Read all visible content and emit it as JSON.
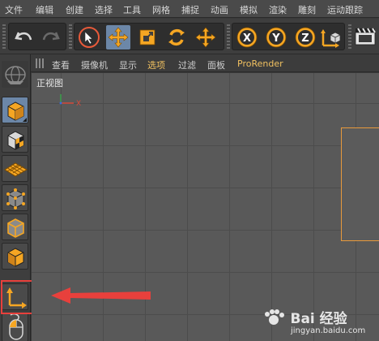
{
  "menu": [
    "文件",
    "编辑",
    "创建",
    "选择",
    "工具",
    "网格",
    "捕捉",
    "动画",
    "模拟",
    "渲染",
    "雕刻",
    "运动跟踪"
  ],
  "toolbar": {
    "undo_icon": "undo-icon",
    "redo_icon": "redo-icon",
    "tools": [
      "live-select-icon",
      "move-icon",
      "scale-icon",
      "rotate-icon",
      "move-plus-icon"
    ],
    "axes": [
      "X",
      "Y",
      "Z"
    ],
    "world_icon": "coordinate-system-icon",
    "render_icon": "clapper-icon"
  },
  "left_palette": [
    "cube-edit-icon",
    "texture-cube-icon",
    "plane-grid-icon",
    "points-cube-icon",
    "edges-cube-icon",
    "polygons-cube-icon",
    "axis-icon",
    "mouse-icon"
  ],
  "viewport": {
    "menu": [
      "查看",
      "摄像机",
      "显示",
      "选项",
      "过滤",
      "面板",
      "ProRender"
    ],
    "label": "正视图",
    "axis_x": "X"
  },
  "watermark": {
    "logo": "Bai 经验",
    "url": "jingyan.baidu.com"
  },
  "colors": {
    "accent_orange": "#f0a23a",
    "highlight_blue": "#6c87a8",
    "annotation_red": "#e8403c",
    "frame_orange": "#e89a3c"
  }
}
